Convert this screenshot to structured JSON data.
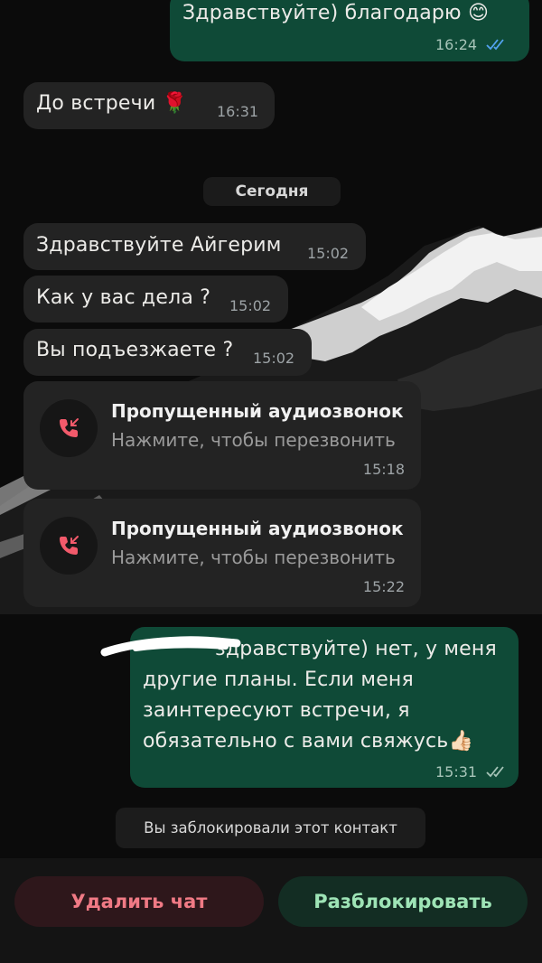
{
  "messages": [
    {
      "direction": "out",
      "text": "Здравствуйте) благодарю 😊",
      "time": "16:24",
      "status": "read"
    },
    {
      "direction": "in",
      "text": "До встречи 🌹",
      "time": "16:31"
    },
    {
      "direction": "in",
      "text": "Здравствуйте Айгерим",
      "time": "15:02"
    },
    {
      "direction": "in",
      "text": "Как у вас дела ?",
      "time": "15:02"
    },
    {
      "direction": "in",
      "text": "Вы подъезжаете ?",
      "time": "15:02"
    },
    {
      "direction": "out",
      "lines": [
        "здравствуйте) нет, у меня",
        "другие планы. Если меня",
        "заинтересуют встречи, я",
        "обязательно с вами свяжусь👍🏻"
      ],
      "time": "15:31",
      "status": "delivered"
    }
  ],
  "date_separator": "Сегодня",
  "missed_calls": [
    {
      "title": "Пропущенный аудиозвонок",
      "subtitle": "Нажмите, чтобы перезвонить",
      "time": "15:18",
      "icon": "missed-call-icon"
    },
    {
      "title": "Пропущенный аудиозвонок",
      "subtitle": "Нажмите, чтобы перезвонить",
      "time": "15:22",
      "icon": "missed-call-icon"
    }
  ],
  "system_notice": "Вы заблокировали этот контакт",
  "actions": {
    "delete_chat": "Удалить чат",
    "unblock": "Разблокировать"
  },
  "colors": {
    "background": "#0b0b0b",
    "incoming_bubble": "#232323",
    "outgoing_bubble": "#0f4a37",
    "read_ticks": "#53a3f0",
    "missed_call": "#f25a6b",
    "delete_text": "#f07a85",
    "unblock_text": "#9ee4b6"
  }
}
